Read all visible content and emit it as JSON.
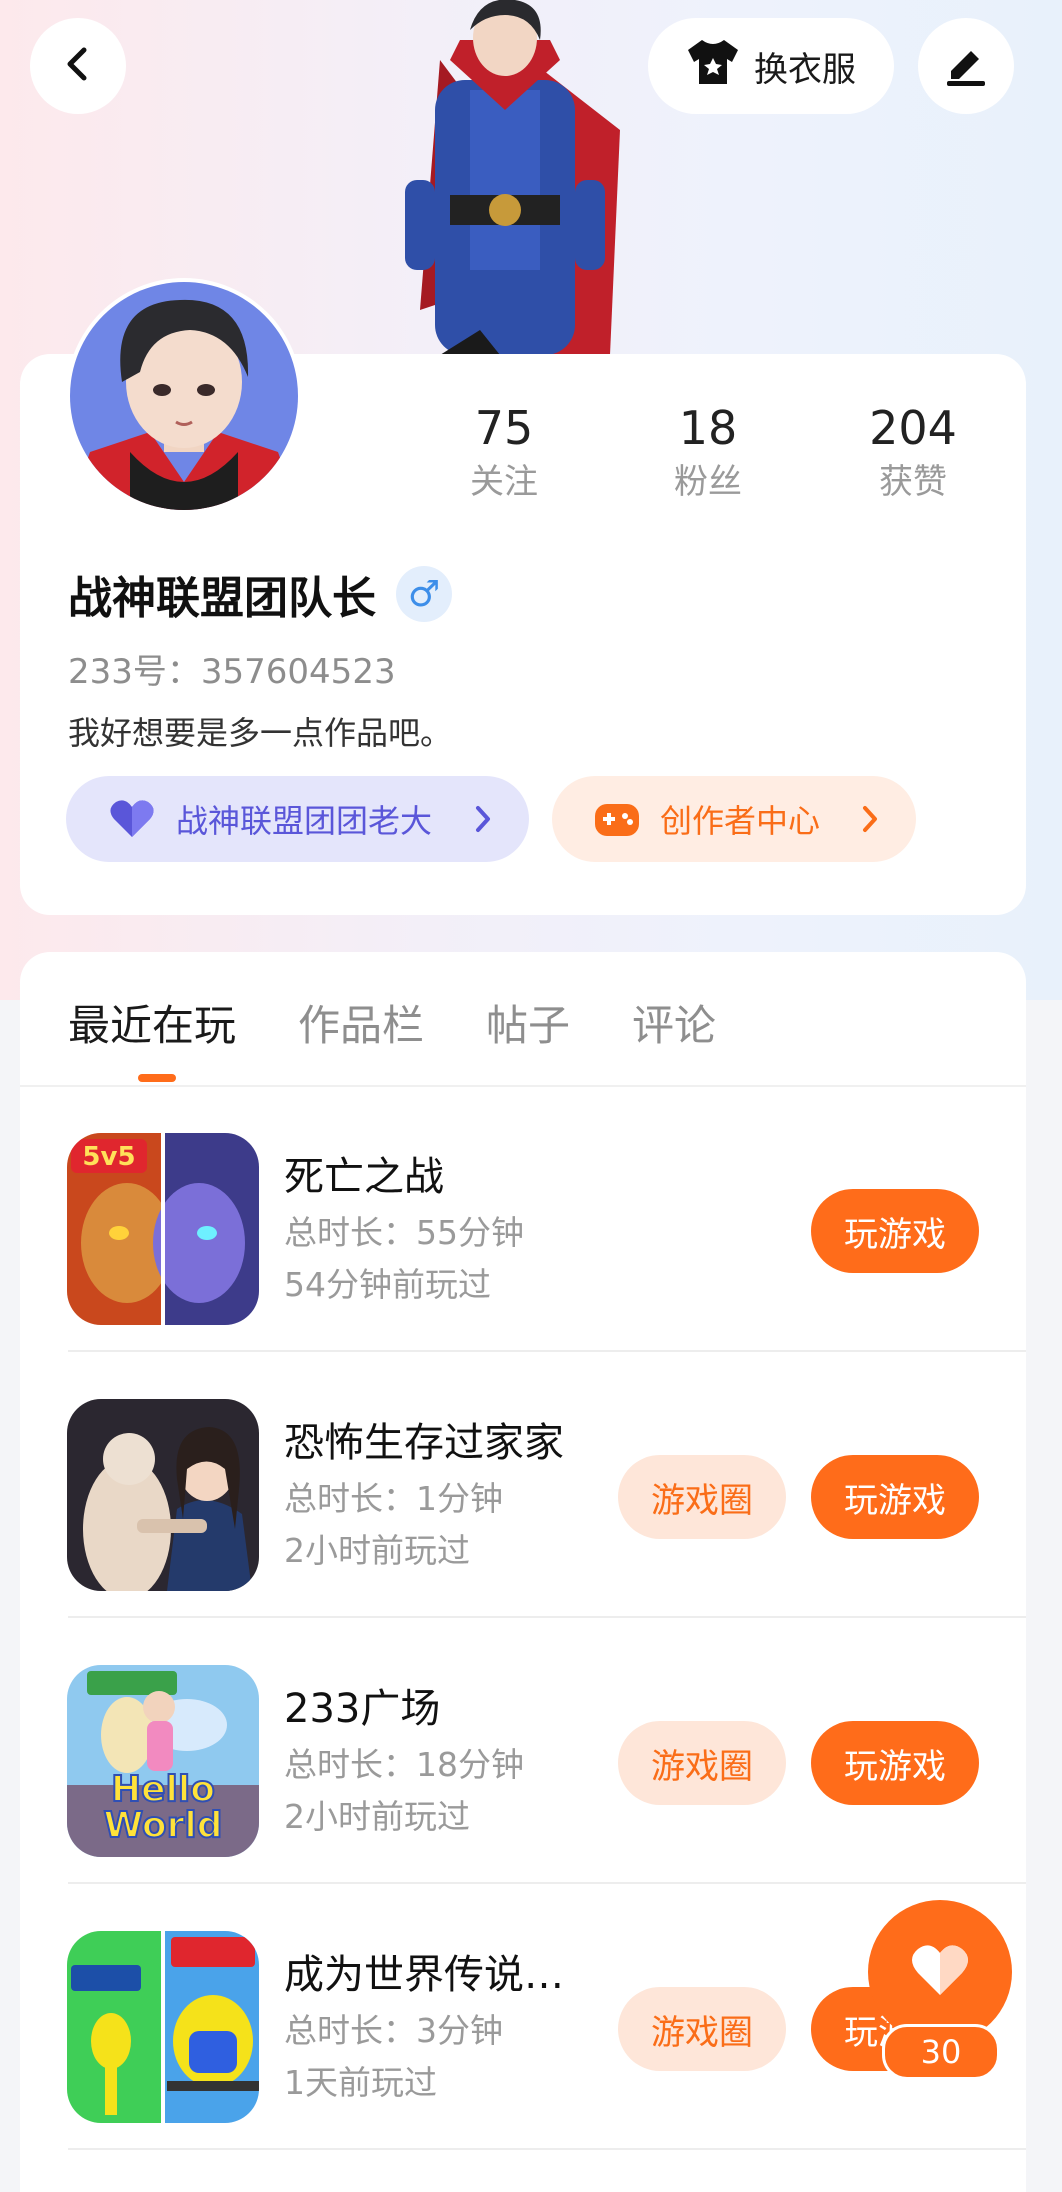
{
  "header": {
    "back_icon": "chevron-left-icon",
    "dress_label": "换衣服",
    "dress_icon": "tshirt-icon",
    "edit_icon": "pencil-icon"
  },
  "profile": {
    "stats": [
      {
        "value": "75",
        "label": "关注"
      },
      {
        "value": "18",
        "label": "粉丝"
      },
      {
        "value": "204",
        "label": "获赞"
      }
    ],
    "username": "战神联盟团队长",
    "gender": "♂",
    "uid": "233号：357604523",
    "bio": "我好想要是多一点作品吧。",
    "team_pill": "战神联盟团团老大",
    "creator_pill": "创作者中心"
  },
  "tabs": [
    {
      "label": "最近在玩",
      "active": true
    },
    {
      "label": "作品栏",
      "active": false
    },
    {
      "label": "帖子",
      "active": false
    },
    {
      "label": "评论",
      "active": false
    }
  ],
  "games": [
    {
      "name": "死亡之战",
      "duration": "总时长：55分钟",
      "last_played": "54分钟前玩过",
      "play_label": "玩游戏",
      "circle_label": ""
    },
    {
      "name": "恐怖生存过家家",
      "duration": "总时长：1分钟",
      "last_played": "2小时前玩过",
      "play_label": "玩游戏",
      "circle_label": "游戏圈"
    },
    {
      "name": "233广场",
      "duration": "总时长：18分钟",
      "last_played": "2小时前玩过",
      "play_label": "玩游戏",
      "circle_label": "游戏圈"
    },
    {
      "name": "成为世界传说…",
      "duration": "总时长：3分钟",
      "last_played": "1天前玩过",
      "play_label": "玩游戏",
      "circle_label": "游戏圈"
    }
  ],
  "like": {
    "count": "30",
    "icon": "heart-icon"
  },
  "colors": {
    "accent": "#ff6c1a",
    "team": "#5a56d9"
  }
}
